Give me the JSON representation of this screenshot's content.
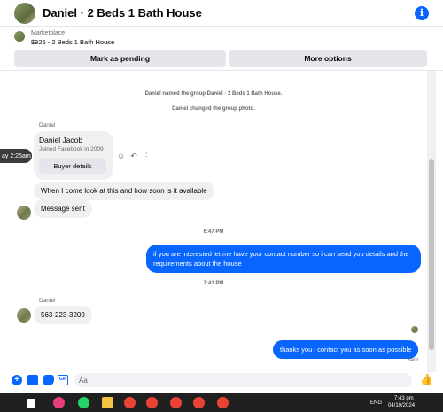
{
  "header": {
    "title": "Daniel · 2 Beds 1 Bath House",
    "info_icon": "i"
  },
  "marketplace": {
    "label": "Marketplace",
    "item": "$925 - 2 Beds 1 Bath House",
    "pending_button": "Mark as pending",
    "more_button": "More options"
  },
  "thread": {
    "system_1": "Daniel named the group Daniel · 2 Beds 1 Bath House.",
    "system_2": "Daniel changed the group photo.",
    "sender_1": "Daniel",
    "card": {
      "name": "Daniel Jacob",
      "joined": "Joined Facebook in 2009",
      "button": "Buyer details"
    },
    "tooltip": "ay 2:25am",
    "msg_1": "When I come look at this and how soon is it available",
    "msg_2": "Message sent",
    "time_1": "6:47 PM",
    "msg_out_1": "if you are interested let me have your contact number so i can send you details and the requirements about the house",
    "time_2": "7:41 PM",
    "sender_2": "Daniel",
    "msg_3": "563-223-3209",
    "msg_out_2": "thanks you i contact you as soon as possible",
    "sent_label": "Sent"
  },
  "composer": {
    "placeholder": "Aa"
  },
  "taskbar": {
    "lang": "ENG",
    "time": "7:43 pm",
    "date": "04/10/2024"
  },
  "colors": {
    "accent": "#0866ff",
    "bubble_in": "#f0f0f0",
    "taskbar": "#202020"
  }
}
